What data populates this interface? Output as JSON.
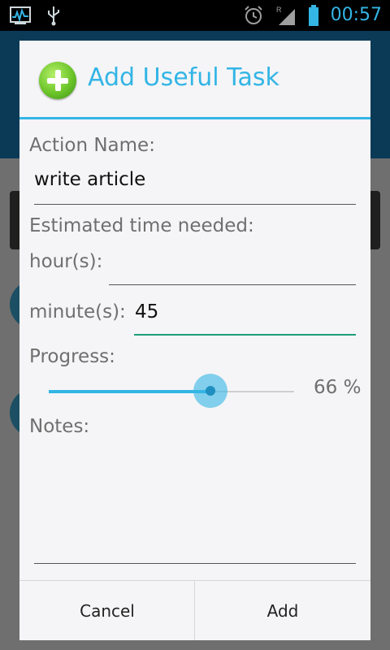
{
  "status_bar": {
    "time": "00:57",
    "icons": [
      "activity-monitor-icon",
      "usb-icon",
      "alarm-icon",
      "signal-icon",
      "battery-icon"
    ]
  },
  "dialog": {
    "title": "Add Useful Task",
    "icon": "add-circle-icon",
    "action_name_label": "Action Name:",
    "action_name_value": "write article",
    "estimated_time_label": "Estimated time needed:",
    "hours_label": "hour(s):",
    "hours_value": "",
    "minutes_label": "minute(s):",
    "minutes_value": "45",
    "progress_label": "Progress:",
    "progress_value": 66,
    "progress_text": "66 %",
    "notes_label": "Notes:",
    "notes_value": "",
    "cancel_label": "Cancel",
    "add_label": "Add"
  },
  "colors": {
    "accent": "#33b5e5",
    "focus_underline": "#1d9e7a",
    "add_icon_green": "#6cc52a"
  }
}
